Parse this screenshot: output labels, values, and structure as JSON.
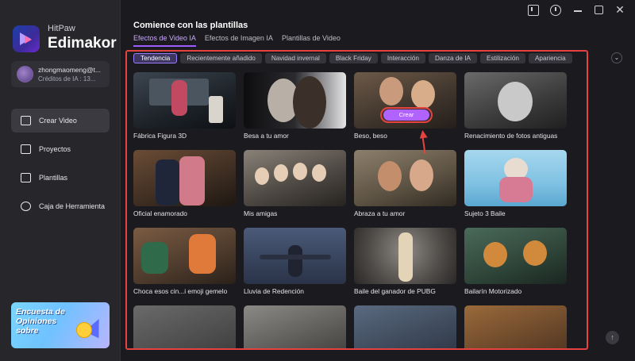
{
  "brand": {
    "top": "HitPaw",
    "main": "Edimakor"
  },
  "user": {
    "email": "zhongmaomeng@t...",
    "credits": "Créditos de IA : 13..."
  },
  "nav": [
    {
      "label": "Crear Video",
      "icon": "video-camera-icon",
      "active": true
    },
    {
      "label": "Proyectos",
      "icon": "folder-icon",
      "active": false
    },
    {
      "label": "Plantillas",
      "icon": "template-icon",
      "active": false
    },
    {
      "label": "Caja de Herramienta",
      "icon": "toolbox-icon",
      "active": false
    }
  ],
  "banner": {
    "text": "Encuesta de Opiniones sobre"
  },
  "window_controls": [
    "feedback-icon",
    "info-icon",
    "minimize-icon",
    "maximize-icon",
    "close-icon"
  ],
  "page_title": "Comience con las plantillas",
  "tabs": [
    "Efectos de Video IA",
    "Efectos de Imagen IA",
    "Plantillas de Video"
  ],
  "chips": [
    "Tendencia",
    "Recientemente añadido",
    "Navidad invernal",
    "Black Friday",
    "Interacción",
    "Danza de IA",
    "Estilización",
    "Apariencia"
  ],
  "cards": [
    {
      "label": "Fábrica Figura 3D"
    },
    {
      "label": "Besa a tu amor"
    },
    {
      "label": "Beso, beso",
      "button": "Crear"
    },
    {
      "label": "Renacimiento de fotos antiguas"
    },
    {
      "label": "Oficial enamorado"
    },
    {
      "label": "Mis amigas"
    },
    {
      "label": "Abraza a tu amor"
    },
    {
      "label": "Sujeto 3 Baile"
    },
    {
      "label": "Choca esos cin...i emoji gemelo"
    },
    {
      "label": "Lluvia de Redención"
    },
    {
      "label": "Baile del ganador de PUBG"
    },
    {
      "label": "Bailarín Motorizado"
    },
    {
      "label": ""
    },
    {
      "label": ""
    },
    {
      "label": ""
    },
    {
      "label": ""
    }
  ],
  "colors": {
    "accent": "#9d5cff",
    "highlight": "#e5433f",
    "background": "#1b1b1f",
    "sidebar": "#26262b"
  }
}
